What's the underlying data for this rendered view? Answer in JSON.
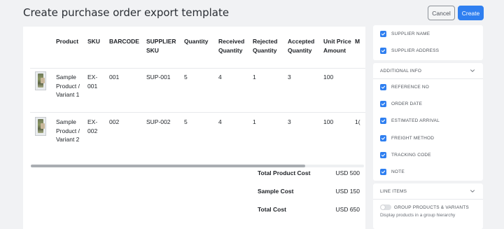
{
  "header": {
    "title": "Create purchase order export template",
    "cancel_label": "Cancel",
    "create_label": "Create"
  },
  "table": {
    "columns": [
      "Product",
      "SKU",
      "BARCODE",
      "SUPPLIER SKU",
      "Quantity",
      "Received Quantity",
      "Rejected Quantity",
      "Accepted Quantity",
      "Unit Price Amount",
      "M"
    ],
    "rows": [
      {
        "product": "Sample Product / Variant 1",
        "sku": "EX-001",
        "barcode": "001",
        "supplier_sku": "SUP-001",
        "quantity": "5",
        "received": "4",
        "rejected": "1",
        "accepted": "3",
        "unit_price": "100",
        "extra": ""
      },
      {
        "product": "Sample Product / Variant 2",
        "sku": "EX-002",
        "barcode": "002",
        "supplier_sku": "SUP-002",
        "quantity": "5",
        "received": "4",
        "rejected": "1",
        "accepted": "3",
        "unit_price": "100",
        "extra": "1("
      }
    ]
  },
  "summary": [
    {
      "label": "Total Product Cost",
      "value": "USD 500"
    },
    {
      "label": "Sample Cost",
      "value": "USD 150"
    },
    {
      "label": "Total Cost",
      "value": "USD 650"
    }
  ],
  "sidebar": {
    "supplier_items": [
      "SUPPLIER NAME",
      "SUPPLIER ADDRESS"
    ],
    "additional_info": {
      "title": "ADDITIONAL INFO",
      "items": [
        "REFERENCE NO",
        "ORDER DATE",
        "ESTIMATED ARRIVAL",
        "FREIGHT METHOD",
        "TRACKING CODE",
        "NOTE"
      ]
    },
    "line_items": {
      "title": "LINE ITEMS",
      "toggle_label": "GROUP PRODUCTS & VARIANTS",
      "toggle_on": false,
      "toggle_help": "Display products in a group hierarchy"
    }
  },
  "colors": {
    "accent": "#2f7ff0",
    "background": "#f1f2f4",
    "card": "#ffffff"
  }
}
